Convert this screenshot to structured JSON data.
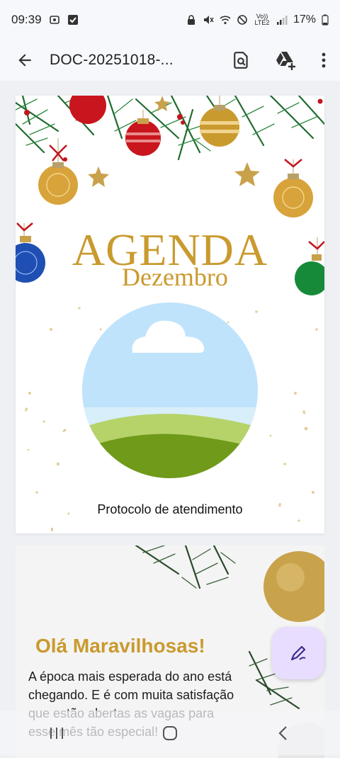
{
  "status": {
    "time": "09:39",
    "net_label": "Vo)) LTE2",
    "battery": "17%"
  },
  "appbar": {
    "title": "DOC-20251018-..."
  },
  "page1": {
    "title": "AGENDA",
    "subtitle": "Dezembro",
    "protocol": "Protocolo de atendimento"
  },
  "page2": {
    "greeting": "Olá Maravilhosas!",
    "body": "A época mais esperada do ano está chegando. E é com muita satisfação que estão abertas as vagas para esse mês tão especial!"
  },
  "icons": {
    "back": "arrow-left",
    "search_doc": "document-search",
    "drive_add": "google-drive-add",
    "menu": "more-vert",
    "fab": "edit-pen",
    "nav_recent": "recent-apps",
    "nav_home": "home",
    "nav_back": "back"
  },
  "colors": {
    "accent_gold": "#c99a2e",
    "fab_bg": "#e8ddff",
    "fab_icon": "#3d2b8e",
    "appbar_bg": "#f7f8fc"
  }
}
